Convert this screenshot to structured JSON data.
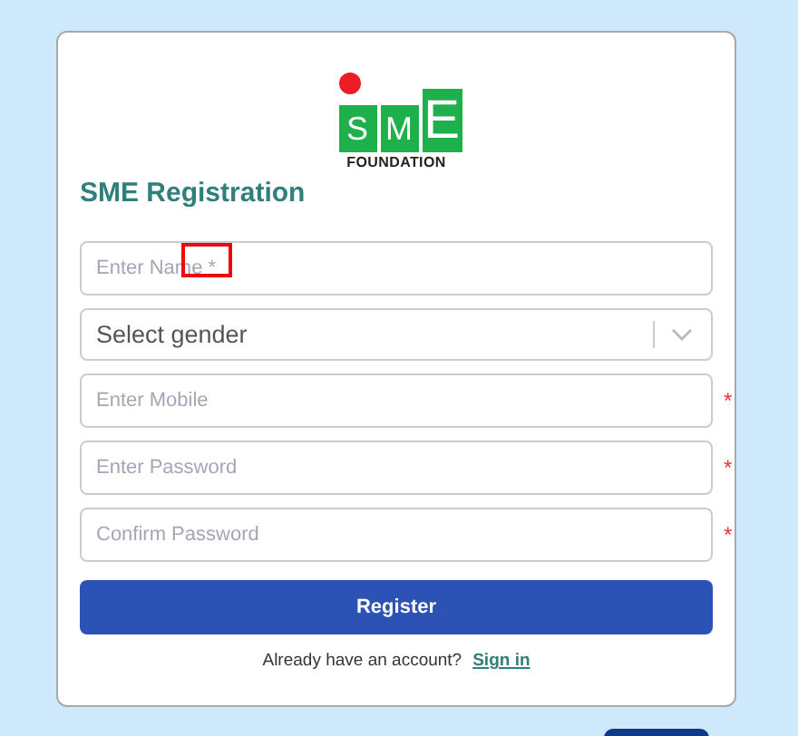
{
  "logo": {
    "letters": [
      "S",
      "M",
      "E"
    ],
    "subtitle": "FOUNDATION"
  },
  "title": "SME Registration",
  "fields": [
    {
      "kind": "text",
      "placeholder": "Enter Name *",
      "highlighted": true
    },
    {
      "kind": "select",
      "placeholder": "Select gender"
    },
    {
      "kind": "text",
      "placeholder": "Enter Mobile",
      "required_mark": "*"
    },
    {
      "kind": "password",
      "placeholder": "Enter Password",
      "required_mark": "*"
    },
    {
      "kind": "password",
      "placeholder": "Confirm Password",
      "required_mark": "*"
    }
  ],
  "submit": "Register",
  "footer": {
    "text": "Already have an account?",
    "link": "Sign in"
  }
}
